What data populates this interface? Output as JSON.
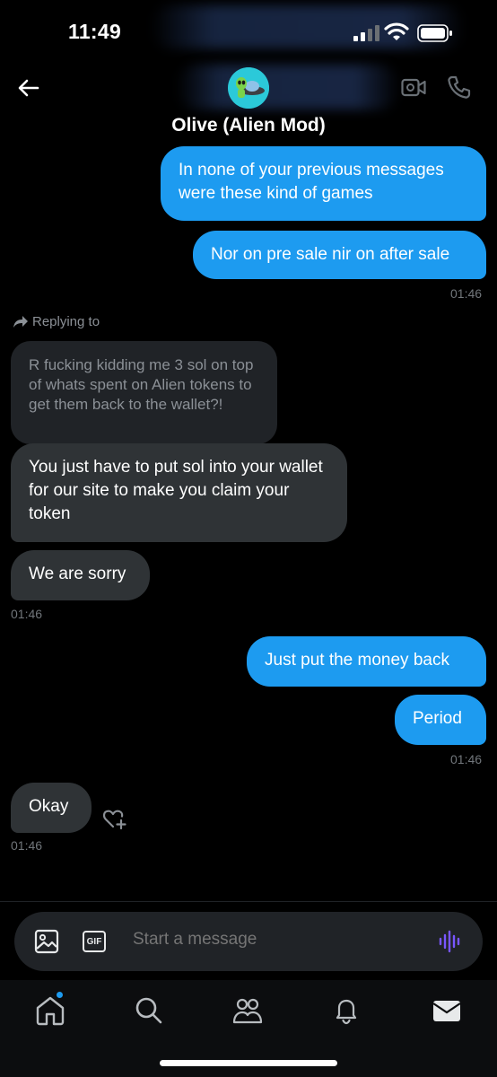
{
  "status_bar": {
    "time": "11:49"
  },
  "header": {
    "contact_name": "Olive (Alien Mod)",
    "back_icon": "arrow-left-icon",
    "video_icon": "video-camera-icon",
    "call_icon": "phone-icon",
    "avatar_icon": "alien-ufo-avatar"
  },
  "messages": {
    "m1": "In none of your previous messages were these kind of games",
    "m2": "Nor on pre sale nir on after sale",
    "t1": "01:46",
    "reply_label": "Replying to",
    "quoted": "R fucking kidding me 3 sol on top of whats spent on Alien tokens to get them back to the wallet?!",
    "m3": "You just have to put sol into your wallet for our site to make you claim your token",
    "m4": "We are sorry",
    "t2": "01:46",
    "m5": "Just put the money back",
    "m6": "Period",
    "t3": "01:46",
    "m7": "Okay",
    "t4": "01:46"
  },
  "composer": {
    "placeholder": "Start a message",
    "gif_label": "GIF"
  },
  "tabbar": {
    "items": [
      "home-icon",
      "search-icon",
      "communities-icon",
      "notifications-icon",
      "messages-icon"
    ]
  },
  "colors": {
    "outgoing": "#1d9bf0",
    "incoming": "#2f3336",
    "voice_accent": "#7856ff"
  }
}
